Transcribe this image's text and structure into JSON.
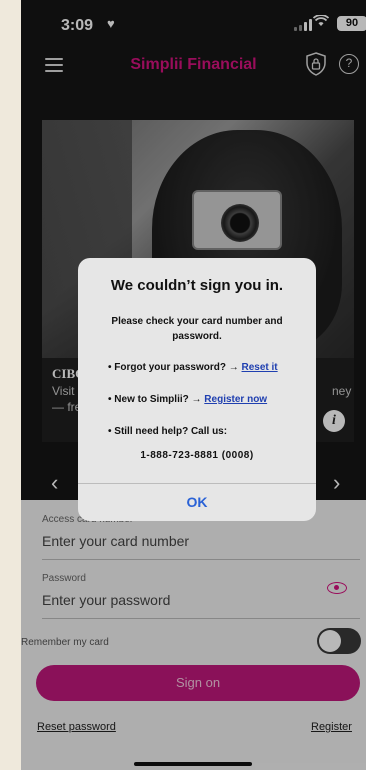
{
  "status_bar": {
    "time": "3:09",
    "heart": "♥",
    "battery": "90"
  },
  "header": {
    "brand": "Simplii Financial"
  },
  "card": {
    "title": "CIBC",
    "text_line1": "Visit",
    "text_line2": "— fre",
    "text_right": "ney"
  },
  "carousel": {
    "prev": "‹",
    "next": "›"
  },
  "alert": {
    "title": "We couldn’t sign you in.",
    "message": "Please check your card number and password.",
    "forgot_text": "Forgot your password? →",
    "forgot_link": "Reset it",
    "new_text": "New to Simplii? →",
    "new_link": "Register now",
    "help_text": "Still need help? Call us:",
    "phone": "1-888-723-8881 (0008)",
    "ok_label": "OK"
  },
  "form": {
    "card_label": "Access card number",
    "card_placeholder": "Enter your card number",
    "password_label": "Password",
    "password_placeholder": "Enter your password",
    "remember_label": "Remember my card",
    "sign_on_label": "Sign on",
    "reset_link": "Reset password",
    "register_link": "Register"
  },
  "colors": {
    "brand": "#d4127f",
    "button": "#c0187c",
    "link": "#1f3fb0",
    "ok": "#2a62d6"
  }
}
